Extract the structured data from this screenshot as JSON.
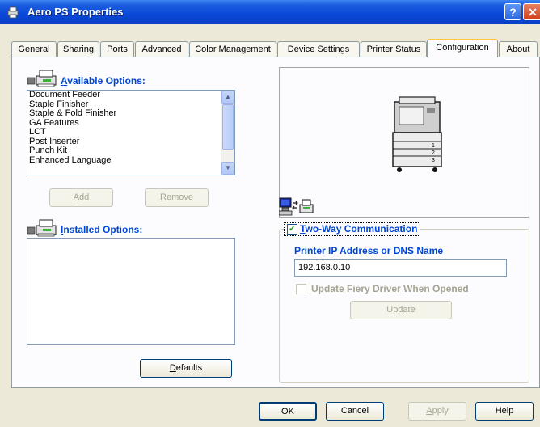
{
  "window": {
    "title": "Aero PS Properties",
    "help_glyph": "?",
    "close_glyph": "✕"
  },
  "tabs": [
    {
      "label": "General"
    },
    {
      "label": "Sharing"
    },
    {
      "label": "Ports"
    },
    {
      "label": "Advanced"
    },
    {
      "label": "Color Management"
    },
    {
      "label": "Device Settings"
    },
    {
      "label": "Printer Status"
    },
    {
      "label": "Configuration"
    },
    {
      "label": "About"
    }
  ],
  "available": {
    "label_u": "A",
    "label_rest": "vailable Options:",
    "items": [
      "Document Feeder",
      "Staple Finisher",
      "Staple & Fold  Finisher",
      "GA Features",
      "LCT",
      "Post Inserter",
      "Punch Kit",
      "Enhanced Language"
    ]
  },
  "add_button": {
    "u": "A",
    "rest": "dd"
  },
  "remove_button": {
    "u": "R",
    "rest": "emove"
  },
  "installed": {
    "label_u": "I",
    "label_rest": "nstalled Options:"
  },
  "defaults_button": {
    "u": "D",
    "rest": "efaults"
  },
  "two_way": {
    "label_u": "T",
    "label_rest": "wo-Way Communication",
    "check": "✓"
  },
  "ip": {
    "label": "Printer IP Address or DNS Name",
    "value": "192.168.0.10"
  },
  "update_driver": {
    "label": "Update Fiery Driver When Opened"
  },
  "update_button": {
    "label": "Update"
  },
  "footer": {
    "ok": "OK",
    "cancel": "Cancel",
    "apply_u": "A",
    "apply_rest": "pply",
    "help": "Help"
  },
  "colors": {
    "title_blue": "#0a47d8",
    "label_blue": "#0046d5",
    "tab_highlight": "#ffc83c"
  }
}
